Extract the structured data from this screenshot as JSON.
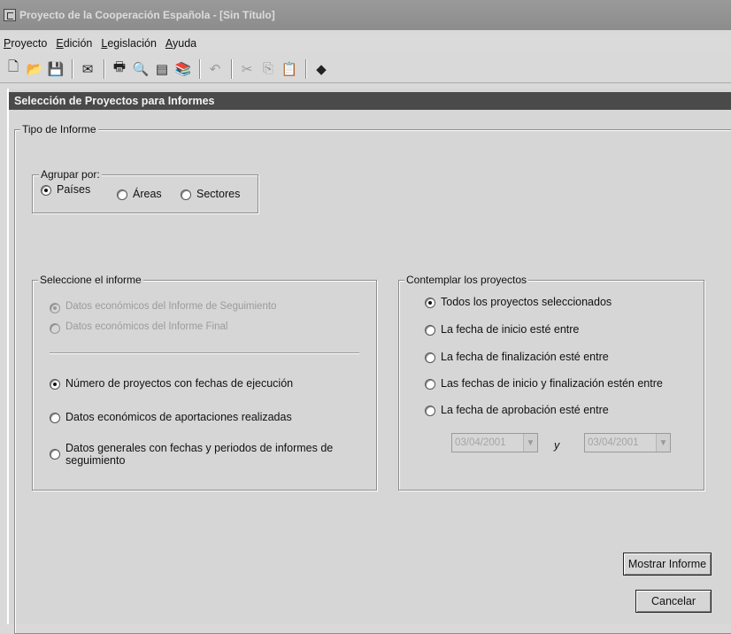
{
  "window": {
    "title": "Proyecto de la Cooperación Española - [Sin Título]"
  },
  "menu": {
    "items": [
      "Proyecto",
      "Edición",
      "Legislación",
      "Ayuda"
    ]
  },
  "toolbar": {
    "icons": [
      "new-document-icon",
      "open-folder-icon",
      "save-icon",
      "mail-icon",
      "print-icon",
      "print-preview-icon",
      "page-setup-icon",
      "books-icon",
      "undo-icon",
      "cut-icon",
      "copy-icon",
      "paste-icon",
      "help-book-icon"
    ]
  },
  "dialog": {
    "title": "Selección de Proyectos para Informes",
    "tipo_label": "Tipo de Informe",
    "agrupar": {
      "label": "Agrupar por:",
      "options": [
        "Países",
        "Áreas",
        "Sectores"
      ],
      "selected": "Países"
    },
    "seleccione": {
      "label": "Seleccione el informe",
      "disabled_options": [
        "Datos económicos del Informe de Seguimiento",
        "Datos económicos del Informe Final"
      ],
      "options": [
        "Número de proyectos con fechas de ejecución",
        "Datos económicos de aportaciones realizadas",
        "Datos generales con fechas y periodos de informes de seguimiento"
      ],
      "selected": "Número de proyectos con fechas de ejecución"
    },
    "contemplar": {
      "label": "Contemplar los proyectos",
      "options": [
        "Todos los proyectos seleccionados",
        "La fecha de inicio esté entre",
        "La fecha de finalización esté entre",
        "Las fechas de inicio y finalización estén entre",
        "La fecha de aprobación esté entre"
      ],
      "selected": "Todos los proyectos seleccionados",
      "date_from": "03/04/2001",
      "conjunction": "y",
      "date_to": "03/04/2001"
    },
    "buttons": {
      "show": "Mostrar Informe",
      "cancel": "Cancelar"
    }
  }
}
